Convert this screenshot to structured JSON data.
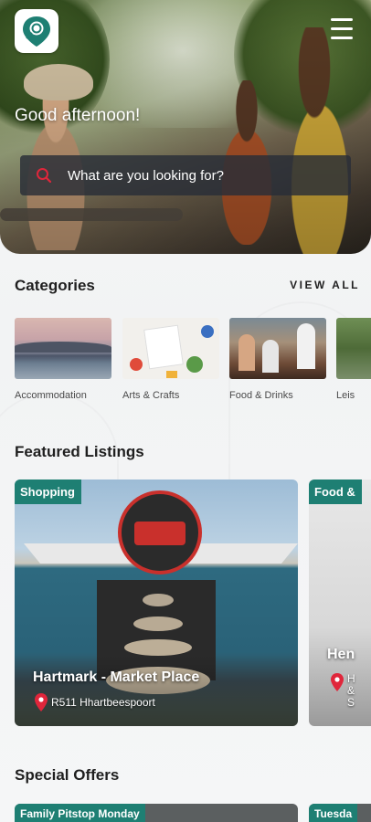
{
  "header": {
    "greeting": "Good afternoon!",
    "search_placeholder": "What are you looking for?"
  },
  "categories": {
    "title": "Categories",
    "view_all": "VIEW ALL",
    "items": [
      {
        "label": "Accommodation"
      },
      {
        "label": "Arts & Crafts"
      },
      {
        "label": "Food & Drinks"
      },
      {
        "label": "Leis"
      }
    ]
  },
  "featured": {
    "title": "Featured Listings",
    "cards": [
      {
        "tag": "Shopping",
        "title": "Hartmark - Market Place",
        "location": "R511 Hhartbeespoort"
      },
      {
        "tag": "Food &",
        "title": "Hen",
        "location": "H & S"
      }
    ]
  },
  "offers": {
    "title": "Special Offers",
    "cards": [
      {
        "tag": "Family Pitstop Monday"
      },
      {
        "tag": "Tuesda"
      }
    ]
  },
  "colors": {
    "accent": "#1e7f73",
    "pin": "#e0263b"
  }
}
